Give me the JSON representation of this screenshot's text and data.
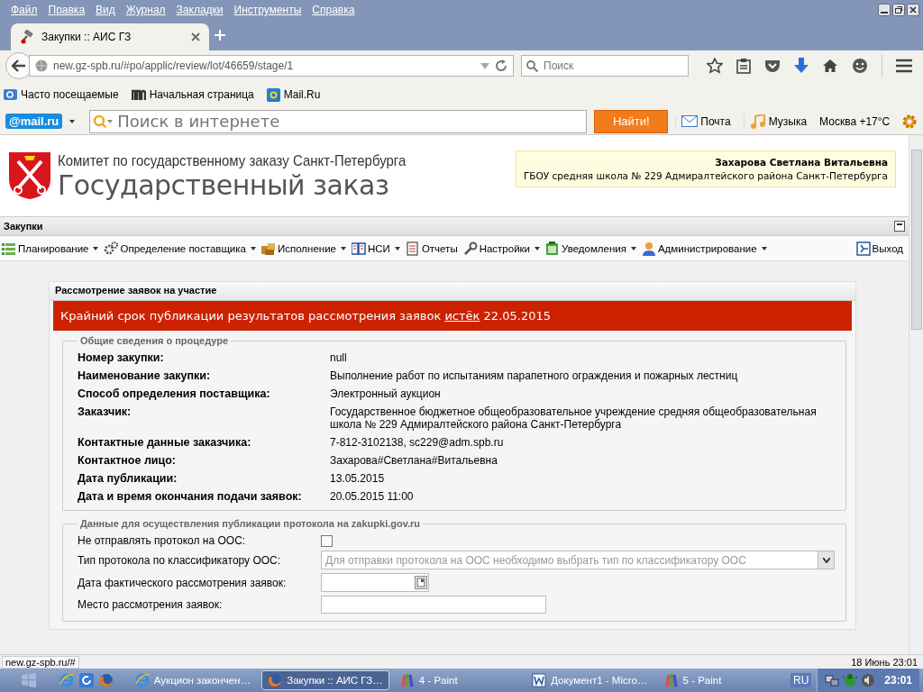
{
  "browser": {
    "menu": [
      "Файл",
      "Правка",
      "Вид",
      "Журнал",
      "Закладки",
      "Инструменты",
      "Справка"
    ],
    "tab": {
      "title": "Закупки :: АИС ГЗ",
      "selected": true
    },
    "address": {
      "url": "new.gz-spb.ru/#po/applic/review/lot/46659/stage/1"
    },
    "search": {
      "placeholder": "Поиск"
    },
    "bookmarks": [
      {
        "label": "Часто посещаемые",
        "kind": "folder"
      },
      {
        "label": "Начальная страница",
        "kind": "m"
      },
      {
        "label": "Mail.Ru",
        "kind": "mail"
      }
    ],
    "mailru": {
      "logo": "@mail.ru",
      "placeholder": "Поиск в интернете",
      "button": "Найти!",
      "mail": "Почта",
      "music": "Музыка",
      "weather": "Москва +17°С"
    }
  },
  "site": {
    "org": "Комитет по государственному заказу Санкт-Петербурга",
    "title": "Государственный заказ",
    "user": {
      "name": "Захарова Светлана Витальевна",
      "org": "ГБОУ средняя школа № 229 Адмиралтейского района Санкт-Петербурга"
    },
    "section": "Закупки",
    "nav": [
      {
        "label": "Планирование",
        "dropdown": true
      },
      {
        "label": "Определение поставщика",
        "dropdown": true
      },
      {
        "label": "Исполнение",
        "dropdown": true
      },
      {
        "label": "НСИ",
        "dropdown": true
      },
      {
        "label": "Отчеты",
        "dropdown": false
      },
      {
        "label": "Настройки",
        "dropdown": true
      },
      {
        "label": "Уведомления",
        "dropdown": true
      },
      {
        "label": "Администрирование",
        "dropdown": true
      }
    ],
    "logout": "Выход"
  },
  "panel": {
    "title": "Рассмотрение заявок на участие",
    "alert": {
      "before": "Крайний срок публикации результатов рассмотрения заявок",
      "link": "истёк",
      "after": "22.05.2015"
    },
    "general": {
      "legend": "Общие сведения о процедуре",
      "rows": [
        {
          "label": "Номер закупки:",
          "value": "null"
        },
        {
          "label": "Наименование закупки:",
          "value": "Выполнение работ по испытаниям парапетного ограждения и пожарных лестниц"
        },
        {
          "label": "Способ определения поставщика:",
          "value": "Электронный аукцион"
        },
        {
          "label": "Заказчик:",
          "value": "Государственное бюджетное общеобразовательное учреждение средняя общеобразовательная школа № 229 Адмиралтейского района Санкт-Петербурга"
        },
        {
          "label": "Контактные данные заказчика:",
          "value": "7-812-3102138, sc229@adm.spb.ru"
        },
        {
          "label": "Контактное лицо:",
          "value": "Захарова#Светлана#Витальевна"
        },
        {
          "label": "Дата публикации:",
          "value": "13.05.2015"
        },
        {
          "label": "Дата и время окончания подачи заявок:",
          "value": "20.05.2015 11:00"
        }
      ]
    },
    "publication": {
      "legend": "Данные для осуществления публикации протокола на zakupki.gov.ru",
      "fields": [
        {
          "kind": "checkbox",
          "label": "Не отправлять протокол на ООС:",
          "checked": false
        },
        {
          "kind": "select",
          "label": "Тип протокола по классификатору ООС:",
          "placeholder": "Для отправки протокола на ООС необходимо выбрать тип по классификатору ООС",
          "disabled": true
        },
        {
          "kind": "date",
          "label": "Дата фактического рассмотрения заявок:"
        },
        {
          "kind": "text",
          "label": "Место рассмотрения заявок:"
        }
      ]
    }
  },
  "status_bar": {
    "url": "new.gz-spb.ru/#",
    "datetime": "18 Июнь 23:01"
  },
  "taskbar": {
    "tasks": [
      {
        "label": "Аукцион закончен…",
        "selected": false
      },
      {
        "label": "Закупки :: АИС ГЗ…",
        "selected": true
      },
      {
        "label": "4 - Paint",
        "selected": false
      },
      {
        "label": "Документ1 - Micro…",
        "selected": false
      },
      {
        "label": "5 - Paint",
        "selected": false
      }
    ],
    "lang": "RU",
    "clock": "23:01"
  }
}
